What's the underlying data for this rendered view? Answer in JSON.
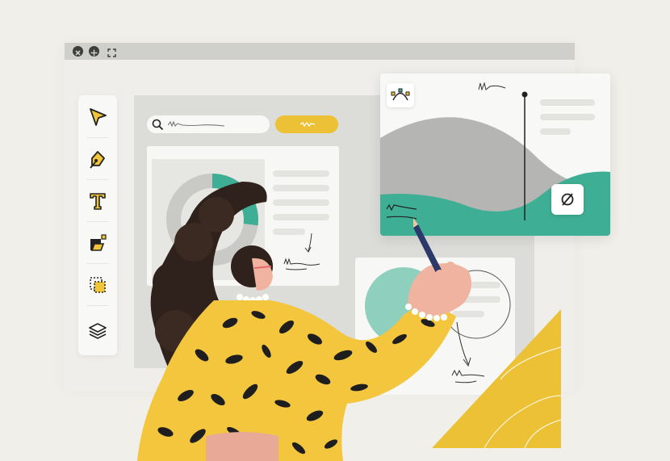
{
  "window": {
    "controls": [
      {
        "icon": "close-icon"
      },
      {
        "icon": "move-icon"
      },
      {
        "icon": "fullscreen-icon"
      }
    ]
  },
  "toolbar": {
    "tools": [
      {
        "icon": "cursor-arrow-icon"
      },
      {
        "icon": "pen-tool-icon"
      },
      {
        "icon": "text-tool-icon"
      },
      {
        "icon": "shape-tool-icon"
      },
      {
        "icon": "frame-select-icon"
      },
      {
        "icon": "layers-icon"
      }
    ]
  },
  "colors": {
    "accent_yellow": "#ecc136",
    "accent_teal": "#3eaf94",
    "tool_yellow": "#f0c53a",
    "grey_shape": "#b5b5b3",
    "jacket_black": "#1e1e1e",
    "hair": "#2f211b"
  },
  "donut": {
    "filled_fraction": 0.27
  }
}
